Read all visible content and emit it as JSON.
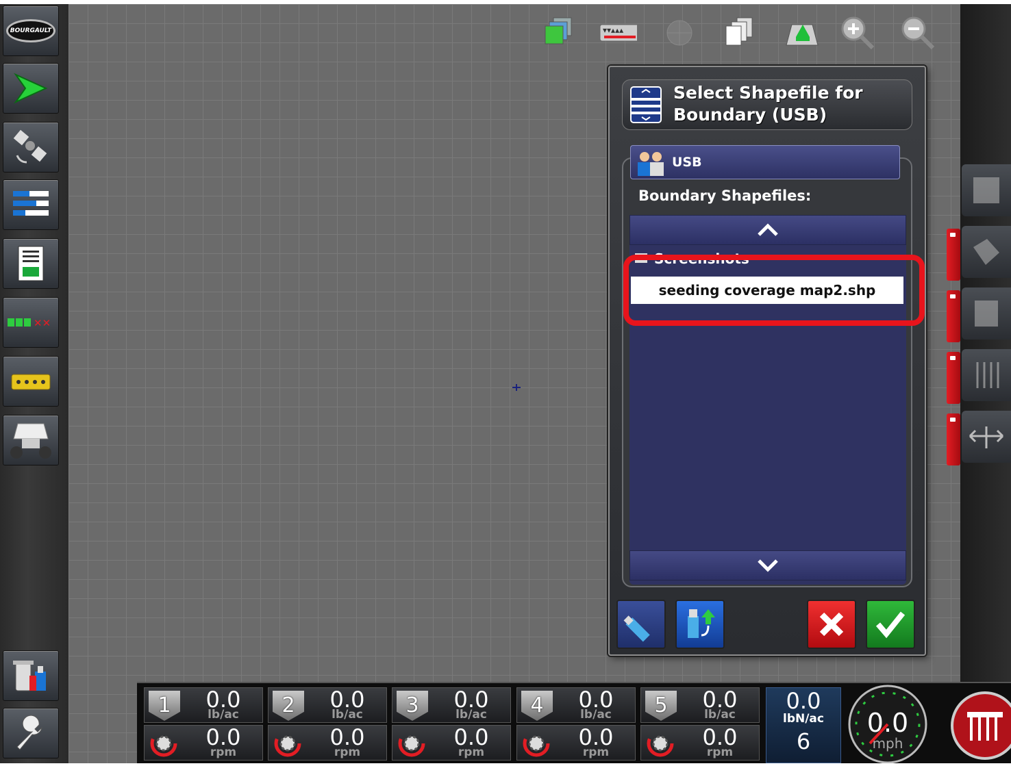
{
  "left_toolbar": {
    "logo_text": "BOURGAULT",
    "items": [
      "guidance",
      "gps",
      "layers",
      "job",
      "sections",
      "implement",
      "drill",
      "usb-manager",
      "settings"
    ]
  },
  "top_toolbar": {
    "icons": [
      "layers-icon",
      "manifold-icon",
      "globe-icon",
      "pages-icon",
      "field-map-icon",
      "zoom-in-icon",
      "zoom-out-icon"
    ]
  },
  "dialog": {
    "title": "Select Shapefile for Boundary (USB)",
    "source_label": "USB",
    "list_label": "Boundary Shapefiles:",
    "folder_item": "Screenshots",
    "file_item": "seeding coverage map2.shp"
  },
  "sections": [
    {
      "number": "1",
      "rate": "0.0",
      "rate_unit": "lb/ac",
      "speed": "0.0",
      "speed_unit": "rpm"
    },
    {
      "number": "2",
      "rate": "0.0",
      "rate_unit": "lb/ac",
      "speed": "0.0",
      "speed_unit": "rpm"
    },
    {
      "number": "3",
      "rate": "0.0",
      "rate_unit": "lb/ac",
      "speed": "0.0",
      "speed_unit": "rpm"
    },
    {
      "number": "4",
      "rate": "0.0",
      "rate_unit": "lb/ac",
      "speed": "0.0",
      "speed_unit": "rpm"
    },
    {
      "number": "5",
      "rate": "0.0",
      "rate_unit": "lb/ac",
      "speed": "0.0",
      "speed_unit": "rpm"
    }
  ],
  "total": {
    "value": "0.0",
    "unit": "lbN/ac",
    "count": "6"
  },
  "speedometer": {
    "value": "0.0",
    "unit": "mph"
  },
  "colors": {
    "accent_red": "#e8141c",
    "list_bg": "#2f3261",
    "confirm_green": "#1f9a2a"
  }
}
